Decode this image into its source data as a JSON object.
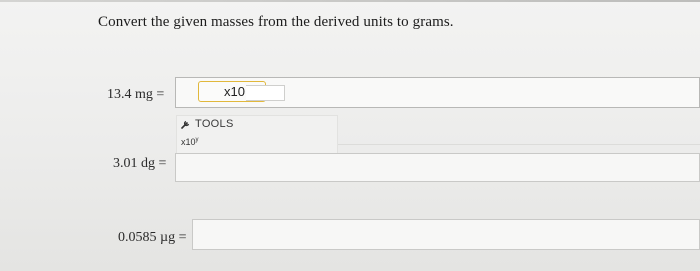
{
  "question": {
    "instructions": "Convert the given masses from the derived units to grams."
  },
  "rows": [
    {
      "label": "13.4 mg =",
      "value": ""
    },
    {
      "label": "3.01 dg =",
      "value": ""
    },
    {
      "label": "0.0585 µg =",
      "value": ""
    }
  ],
  "scientific_notation": {
    "button_label": "x10",
    "entry_value": ""
  },
  "tools": {
    "title": "TOOLS",
    "x10_label": "x10",
    "x10_exponent": "y"
  },
  "colors": {
    "focus_border": "#e1b83c",
    "field_border": "#c9c9c7"
  }
}
